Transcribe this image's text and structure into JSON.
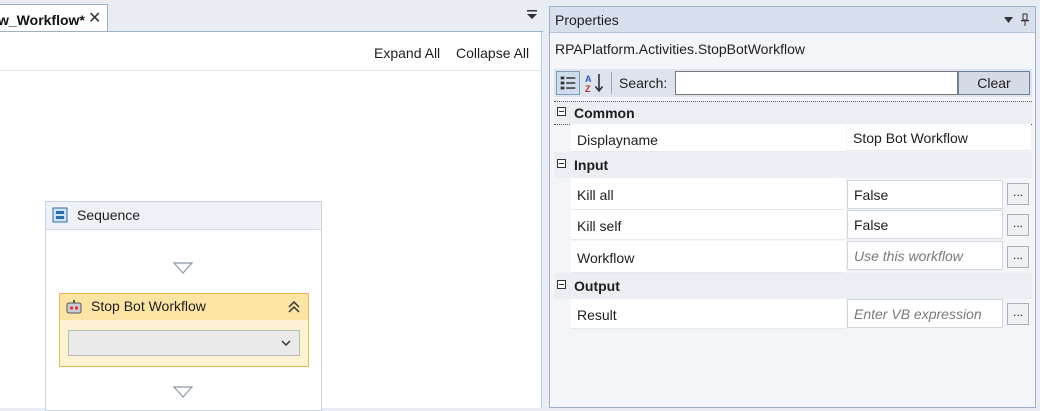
{
  "designer": {
    "tab_title": "w_Workflow*",
    "expand_all": "Expand All",
    "collapse_all": "Collapse All",
    "sequence_title": "Sequence",
    "activity_title": "Stop Bot Workflow",
    "activity_combo_value": ""
  },
  "properties": {
    "panel_title": "Properties",
    "subject": "RPAPlatform.Activities.StopBotWorkflow",
    "search_label": "Search:",
    "search_value": "",
    "clear_label": "Clear",
    "categories": [
      {
        "label": "Common",
        "rows": [
          {
            "name": "Displayname",
            "value": "Stop Bot Workflow"
          }
        ]
      },
      {
        "label": "Input",
        "rows": [
          {
            "name": "Kill all",
            "value": "False"
          },
          {
            "name": "Kill self",
            "value": "False"
          },
          {
            "name": "Workflow",
            "placeholder": "Use this workflow"
          }
        ]
      },
      {
        "label": "Output",
        "rows": [
          {
            "name": "Result",
            "placeholder": "Enter  VB expression"
          }
        ]
      }
    ],
    "ellipsis": "..."
  },
  "colors": {
    "activity_header": "#fbe4a4",
    "activity_border": "#e7b84c",
    "panel_title_bg": "#d7e0ec"
  },
  "icons": [
    "close-icon",
    "tab-dropdown-icon",
    "sequence-icon",
    "drop-arrow-icon",
    "robot-icon",
    "collapse-icon",
    "chevron-down-icon",
    "pin-icon",
    "categorized-icon",
    "sort-alpha-icon"
  ]
}
